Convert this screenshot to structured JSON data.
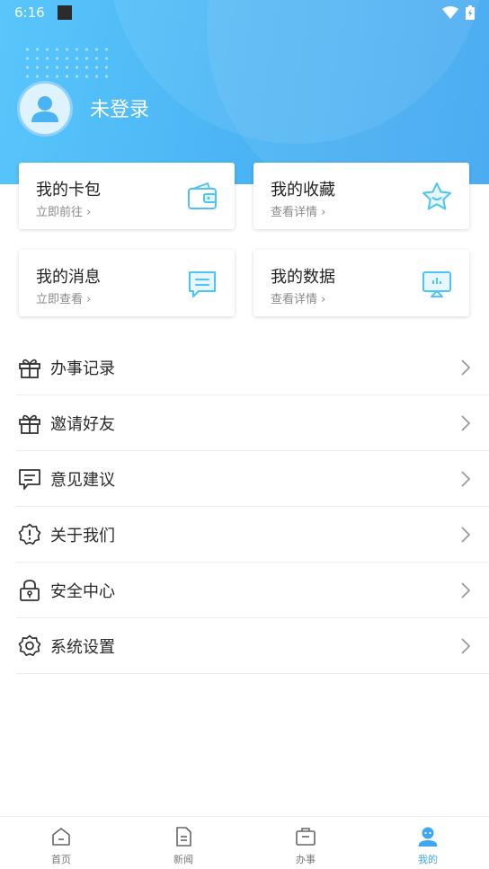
{
  "status_bar": {
    "time": "6:16"
  },
  "profile": {
    "login_text": "未登录"
  },
  "cards": [
    {
      "title": "我的卡包",
      "subtitle": "立即前往 ›",
      "icon": "wallet-icon"
    },
    {
      "title": "我的收藏",
      "subtitle": "查看详情 ›",
      "icon": "star-icon"
    },
    {
      "title": "我的消息",
      "subtitle": "立即查看 ›",
      "icon": "message-icon"
    },
    {
      "title": "我的数据",
      "subtitle": "查看详情 ›",
      "icon": "data-screen-icon"
    }
  ],
  "menu": [
    {
      "label": "办事记录",
      "icon": "gift-icon"
    },
    {
      "label": "邀请好友",
      "icon": "gift-icon"
    },
    {
      "label": "意见建议",
      "icon": "feedback-icon"
    },
    {
      "label": "关于我们",
      "icon": "info-badge-icon"
    },
    {
      "label": "安全中心",
      "icon": "lock-icon"
    },
    {
      "label": "系统设置",
      "icon": "settings-icon"
    }
  ],
  "tabs": [
    {
      "label": "首页",
      "icon": "home-icon",
      "active": false
    },
    {
      "label": "新闻",
      "icon": "news-icon",
      "active": false
    },
    {
      "label": "办事",
      "icon": "briefcase-icon",
      "active": false
    },
    {
      "label": "我的",
      "icon": "user-icon",
      "active": true
    }
  ],
  "colors": {
    "accent": "#3fa6f0",
    "icon_blue": "#4cc4f5",
    "header_start": "#58c6fb",
    "header_end": "#3fa6f0"
  }
}
